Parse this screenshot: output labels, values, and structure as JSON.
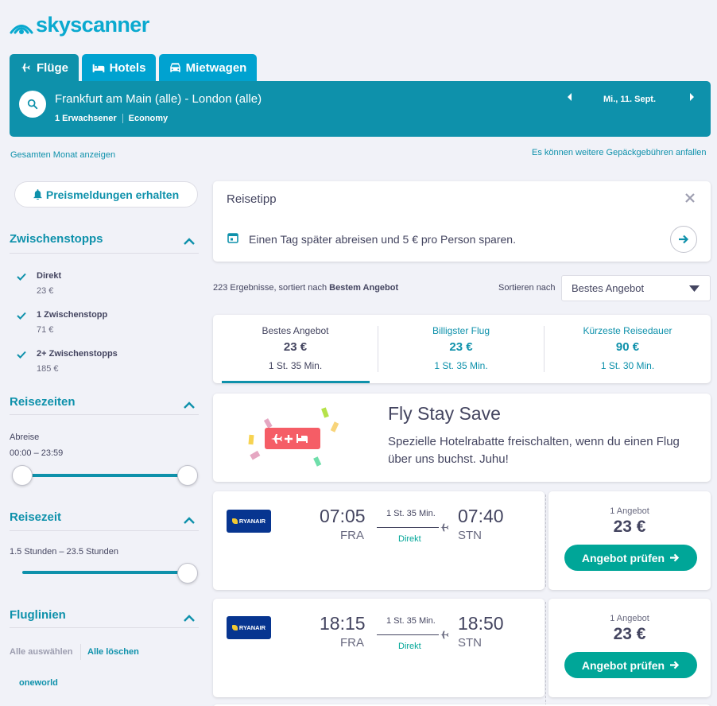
{
  "brand": {
    "name": "skyscanner",
    "color": "#0aa9cf",
    "icon": "skyscanner-sunrise-icon"
  },
  "tabs": [
    {
      "label": "Flüge",
      "icon": "plane-icon",
      "active": true
    },
    {
      "label": "Hotels",
      "icon": "bed-icon",
      "active": false
    },
    {
      "label": "Mietwagen",
      "icon": "car-icon",
      "active": false
    }
  ],
  "search": {
    "route": "Frankfurt am Main (alle) - London (alle)",
    "passengers": "1 Erwachsener",
    "cabin": "Economy",
    "date": "Mi., 11. Sept."
  },
  "links": {
    "month": "Gesamten Monat anzeigen",
    "baggage": "Es können weitere Gepäckgebühren anfallen"
  },
  "sidebar": {
    "price_alert": "Preismeldungen erhalten",
    "stops": {
      "title": "Zwischenstopps",
      "items": [
        {
          "label": "Direkt",
          "price": "23 €",
          "checked": true
        },
        {
          "label": "1 Zwischenstopp",
          "price": "71 €",
          "checked": true
        },
        {
          "label": "2+ Zwischenstopps",
          "price": "185 €",
          "checked": true
        }
      ]
    },
    "times": {
      "title": "Reisezeiten",
      "label": "Abreise",
      "range": "00:00 – 23:59"
    },
    "duration": {
      "title": "Reisezeit",
      "range": "1.5 Stunden – 23.5 Stunden"
    },
    "airlines": {
      "title": "Fluglinien",
      "select_all": "Alle auswählen",
      "clear_all": "Alle löschen",
      "first_group": "oneworld"
    }
  },
  "tip": {
    "title": "Reisetipp",
    "text": "Einen Tag später abreisen und 5 € pro Person sparen."
  },
  "results": {
    "count_text": "223 Ergebnisse, sortiert nach ",
    "count_bold": "Bestem Angebot",
    "sort_label": "Sortieren nach",
    "sort_value": "Bestes Angebot"
  },
  "sort_tabs": [
    {
      "label": "Bestes Angebot",
      "price": "23 €",
      "duration": "1 St. 35 Min.",
      "active": true
    },
    {
      "label": "Billigster Flug",
      "price": "23 €",
      "duration": "1 St. 35 Min.",
      "active": false
    },
    {
      "label": "Kürzeste Reisedauer",
      "price": "90 €",
      "duration": "1 St. 30 Min.",
      "active": false
    }
  ],
  "promo": {
    "title": "Fly Stay Save",
    "text": "Spezielle Hotelrabatte freischalten, wenn du einen Flug über uns buchst. Juhu!"
  },
  "flights": [
    {
      "airline": "RYANAIR",
      "dep_time": "07:05",
      "dep_airport": "FRA",
      "duration": "1 St. 35 Min.",
      "stops": "Direkt",
      "arr_time": "07:40",
      "arr_airport": "STN",
      "offers": "1 Angebot",
      "price": "23 €",
      "cta": "Angebot prüfen"
    },
    {
      "airline": "RYANAIR",
      "dep_time": "18:15",
      "dep_airport": "FRA",
      "duration": "1 St. 35 Min.",
      "stops": "Direkt",
      "arr_time": "18:50",
      "arr_airport": "STN",
      "offers": "1 Angebot",
      "price": "23 €",
      "cta": "Angebot prüfen"
    }
  ],
  "colors": {
    "primary": "#0e91ab",
    "tab": "#00a2d0",
    "cta": "#00a698",
    "background": "#f1f2f8"
  }
}
